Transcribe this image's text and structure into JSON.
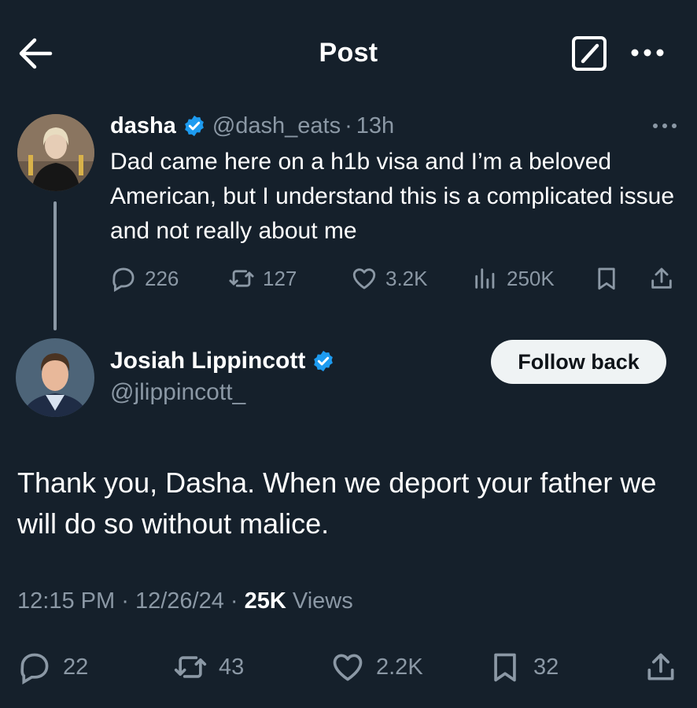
{
  "header": {
    "title": "Post",
    "back_icon": "arrow-left-icon",
    "compose_icon": "compose-icon",
    "more_icon": "more-icon"
  },
  "parent_tweet": {
    "display_name": "dasha",
    "handle": "@dash_eats",
    "separator": "·",
    "time": "13h",
    "text": "Dad came here on a h1b visa and I’m a beloved American, but I understand this is a complicated issue and not really about me",
    "stats": {
      "replies": "226",
      "reposts": "127",
      "likes": "3.2K",
      "views": "250K"
    }
  },
  "main_tweet": {
    "display_name": "Josiah Lippincott",
    "handle": "@jlippincott_",
    "follow_label": "Follow back",
    "text": "Thank you, Dasha. When we deport your father we will do so without malice.",
    "time": "12:15 PM",
    "date": "12/26/24",
    "separator": "·",
    "views_count": "25K",
    "views_label": "Views",
    "stats": {
      "replies": "22",
      "reposts": "43",
      "likes": "2.2K",
      "bookmarks": "32"
    }
  },
  "colors": {
    "background": "#15202b",
    "secondary_text": "#8b98a5",
    "verified": "#1d9bf0",
    "button_bg": "#eff3f4"
  }
}
